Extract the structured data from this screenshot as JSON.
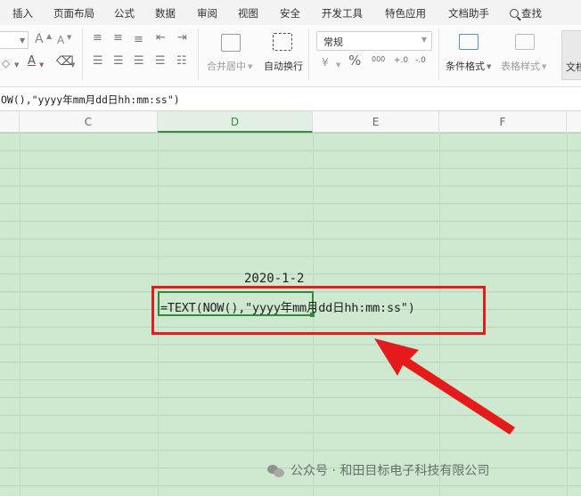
{
  "tabs": [
    "插入",
    "页面布局",
    "公式",
    "数据",
    "审阅",
    "视图",
    "安全",
    "开发工具",
    "特色应用",
    "文档助手",
    "查找"
  ],
  "ribbon": {
    "merge_label": "合并居中",
    "wrap_label": "自动换行",
    "number_format": "常规",
    "cond_format_label": "条件格式",
    "table_style_label": "表格样式",
    "doc_label": "文档",
    "font_grow": "A",
    "font_shrink": "A",
    "percent": "%",
    "thousand": "000",
    "dec_inc": "+.0",
    "dec_dec": "-.0"
  },
  "formula_bar": {
    "content": "OW(),\"yyyy年mm月dd日hh:mm:ss\")"
  },
  "columns": [
    "C",
    "D",
    "E",
    "F"
  ],
  "cells": {
    "d_date": "2020-1-2",
    "d_formula": "=TEXT(NOW(),\"yyyy年mm月dd日hh:mm:ss\")"
  },
  "watermark": {
    "text": "公众号 · 和田目标电子科技有限公司"
  },
  "colors": {
    "grid_green": "#cfe8d0",
    "selection_green": "#2f8b3c",
    "annotation_red": "#e51b1b"
  }
}
